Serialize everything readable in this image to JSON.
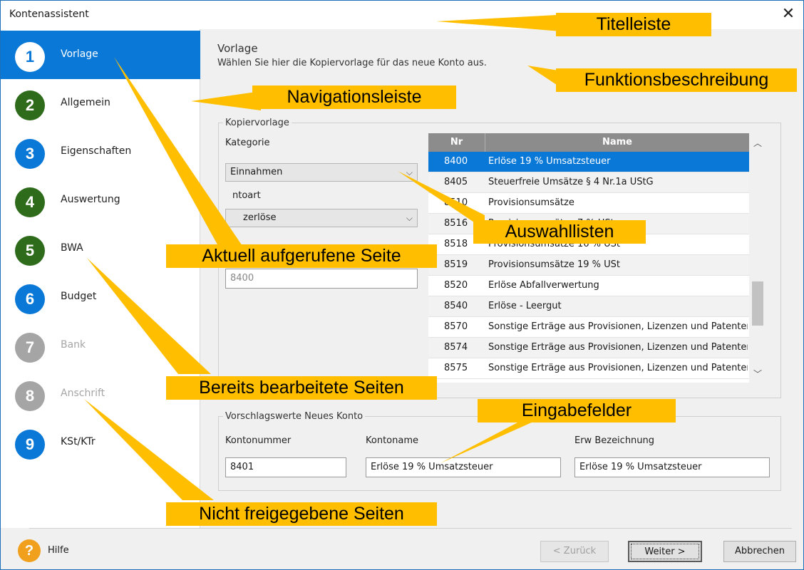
{
  "window": {
    "title": "Kontenassistent",
    "close_glyph": "✕"
  },
  "sidebar": {
    "items": [
      {
        "number": "1",
        "label": "Vorlage",
        "state": "active",
        "color": "#0a78d7"
      },
      {
        "number": "2",
        "label": "Allgemein",
        "state": "done",
        "color": "#2e6b1b"
      },
      {
        "number": "3",
        "label": "Eigenschaften",
        "state": "open",
        "color": "#0a78d7"
      },
      {
        "number": "4",
        "label": "Auswertung",
        "state": "done",
        "color": "#2e6b1b"
      },
      {
        "number": "5",
        "label": "BWA",
        "state": "done",
        "color": "#2e6b1b"
      },
      {
        "number": "6",
        "label": "Budget",
        "state": "open",
        "color": "#0a78d7"
      },
      {
        "number": "7",
        "label": "Bank",
        "state": "disabled",
        "color": "#a5a5a5"
      },
      {
        "number": "8",
        "label": "Anschrift",
        "state": "disabled",
        "color": "#a5a5a5"
      },
      {
        "number": "9",
        "label": "KSt/KTr",
        "state": "open",
        "color": "#0a78d7"
      }
    ]
  },
  "header": {
    "title": "Vorlage",
    "description": "Wählen Sie hier die Kopiervorlage für das neue Konto aus."
  },
  "kopiervorlage": {
    "legend": "Kopiervorlage",
    "kategorie_label": "Kategorie",
    "kategorie_value": "Einnahmen",
    "kontoart_label": "ntoart",
    "kontoart_value": "zerlöse",
    "hidden_value": "8400"
  },
  "table": {
    "headers": [
      "Nr",
      "Name"
    ],
    "rows": [
      {
        "nr": "8400",
        "name": "Erlöse 19 % Umsatzsteuer",
        "selected": true
      },
      {
        "nr": "8405",
        "name": "Steuerfreie Umsätze § 4 Nr.1a UStG"
      },
      {
        "nr": "8510",
        "name": "Provisionsumsätze"
      },
      {
        "nr": "8516",
        "name": "Provisionsumsätze 7 % USt"
      },
      {
        "nr": "8518",
        "name": "Provisionsumsätze 16 % USt"
      },
      {
        "nr": "8519",
        "name": "Provisionsumsätze 19 % USt"
      },
      {
        "nr": "8520",
        "name": "Erlöse Abfallverwertung"
      },
      {
        "nr": "8540",
        "name": "Erlöse - Leergut"
      },
      {
        "nr": "8570",
        "name": "Sonstige Erträge aus Provisionen, Lizenzen und Patenten"
      },
      {
        "nr": "8574",
        "name": "Sonstige Erträge aus Provisionen, Lizenzen und Patenten"
      },
      {
        "nr": "8575",
        "name": "Sonstige Erträge aus Provisionen, Lizenzen und Patenten"
      }
    ]
  },
  "vorschlag": {
    "legend": "Vorschlagswerte Neues Konto",
    "kontonummer_label": "Kontonummer",
    "kontonummer_value": "8401",
    "kontoname_label": "Kontoname",
    "kontoname_value": "Erlöse 19 % Umsatzsteuer",
    "erw_label": "Erw Bezeichnung",
    "erw_value": "Erlöse 19 % Umsatzsteuer"
  },
  "footer": {
    "help_glyph": "?",
    "help_label": "Hilfe",
    "back_label": "< Zurück",
    "next_label": "Weiter >",
    "cancel_label": "Abbrechen"
  },
  "annotations": {
    "titelleiste": "Titelleiste",
    "funktionsbeschreibung": "Funktionsbeschreibung",
    "navigationsleiste": "Navigationsleiste",
    "auswahllisten": "Auswahllisten",
    "aktuell": "Aktuell aufgerufene Seite",
    "eingabefelder": "Eingabefelder",
    "bereits": "Bereits bearbeitete Seiten",
    "nicht": "Nicht freigegebene Seiten",
    "color": "#ffbf00"
  }
}
